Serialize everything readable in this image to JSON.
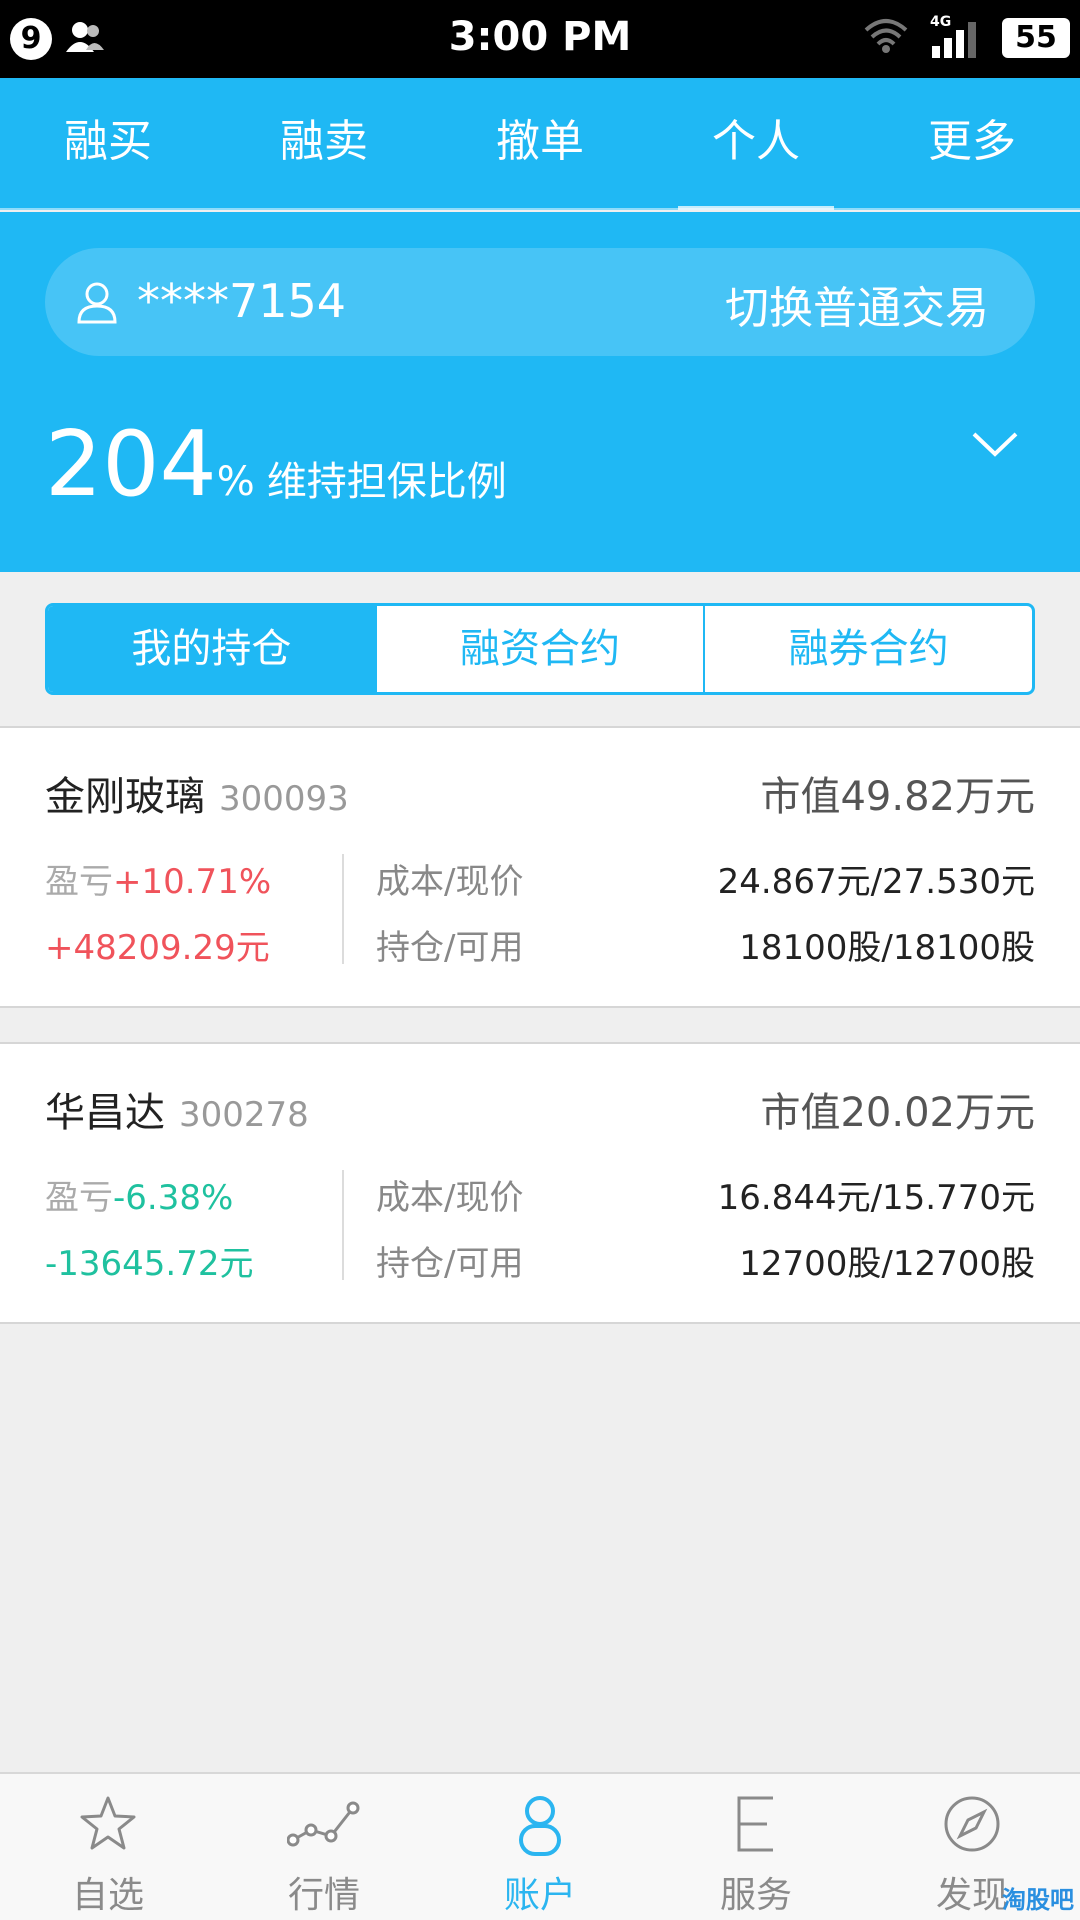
{
  "status_bar": {
    "notification_count": "9",
    "time": "3:00 PM",
    "network": "4G",
    "battery": "55"
  },
  "top_tabs": [
    {
      "label": "融买",
      "active": false
    },
    {
      "label": "融卖",
      "active": false
    },
    {
      "label": "撤单",
      "active": false
    },
    {
      "label": "个人",
      "active": true
    },
    {
      "label": "更多",
      "active": false
    }
  ],
  "account": {
    "masked_id": "****7154",
    "switch_label": "切换普通交易",
    "user_icon": "user-icon"
  },
  "maintenance_ratio": {
    "value": "204",
    "unit": "%",
    "label": "维持担保比例"
  },
  "segments": [
    {
      "label": "我的持仓",
      "active": true
    },
    {
      "label": "融资合约",
      "active": false
    },
    {
      "label": "融券合约",
      "active": false
    }
  ],
  "holdings": [
    {
      "name": "金刚玻璃",
      "code": "300093",
      "market_value": "市值49.82万元",
      "pl_label": "盈亏",
      "pl_pct": "+10.71%",
      "pl_amount": "+48209.29元",
      "cost_label": "成本/现价",
      "cost_value": "24.867元/27.530元",
      "position_label": "持仓/可用",
      "position_value": "18100股/18100股"
    },
    {
      "name": "华昌达",
      "code": "300278",
      "market_value": "市值20.02万元",
      "pl_label": "盈亏",
      "pl_pct": "-6.38%",
      "pl_amount": "-13645.72元",
      "cost_label": "成本/现价",
      "cost_value": "16.844元/15.770元",
      "position_label": "持仓/可用",
      "position_value": "12700股/12700股"
    }
  ],
  "bottom_nav": [
    {
      "label": "自选",
      "icon": "star-icon",
      "active": false
    },
    {
      "label": "行情",
      "icon": "chart-line-icon",
      "active": false
    },
    {
      "label": "账户",
      "icon": "account-icon",
      "active": true
    },
    {
      "label": "服务",
      "icon": "service-icon",
      "active": false
    },
    {
      "label": "发现",
      "icon": "compass-icon",
      "active": false
    }
  ],
  "watermark": "淘股吧",
  "colors": {
    "primary": "#1fb8f4",
    "gain": "#f0535b",
    "loss": "#1fc19f",
    "background": "#efefef"
  }
}
